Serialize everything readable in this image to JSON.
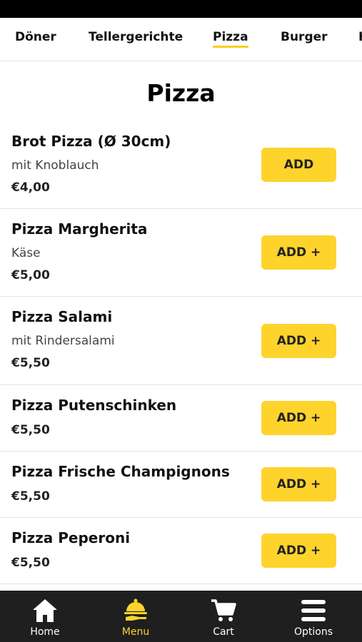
{
  "tabs": [
    {
      "label": "Döner"
    },
    {
      "label": "Tellergerichte"
    },
    {
      "label": "Pizza",
      "active": true
    },
    {
      "label": "Burger"
    },
    {
      "label": "Ki"
    }
  ],
  "section": {
    "title": "Pizza"
  },
  "items": [
    {
      "name": "Brot Pizza (Ø 30cm)",
      "description": "mit Knoblauch",
      "price": "€4,00",
      "button": "ADD"
    },
    {
      "name": "Pizza Margherita",
      "description": "Käse",
      "price": "€5,00",
      "button": "ADD +"
    },
    {
      "name": "Pizza Salami",
      "description": "mit Rindersalami",
      "price": "€5,50",
      "button": "ADD +"
    },
    {
      "name": "Pizza Putenschinken",
      "description": "",
      "price": "€5,50",
      "button": "ADD +"
    },
    {
      "name": "Pizza Frische Champignons",
      "description": "",
      "price": "€5,50",
      "button": "ADD +"
    },
    {
      "name": "Pizza Peperoni",
      "description": "",
      "price": "€5,50",
      "button": "ADD +"
    }
  ],
  "nav": [
    {
      "label": "Home",
      "icon": "home-icon"
    },
    {
      "label": "Menu",
      "icon": "waiter-tray-icon",
      "active": true
    },
    {
      "label": "Cart",
      "icon": "cart-icon"
    },
    {
      "label": "Options",
      "icon": "hamburger-menu-icon"
    }
  ],
  "colors": {
    "accent": "#fed32c",
    "nav_bg": "#1f1f1f",
    "status_bar": "#000000"
  }
}
